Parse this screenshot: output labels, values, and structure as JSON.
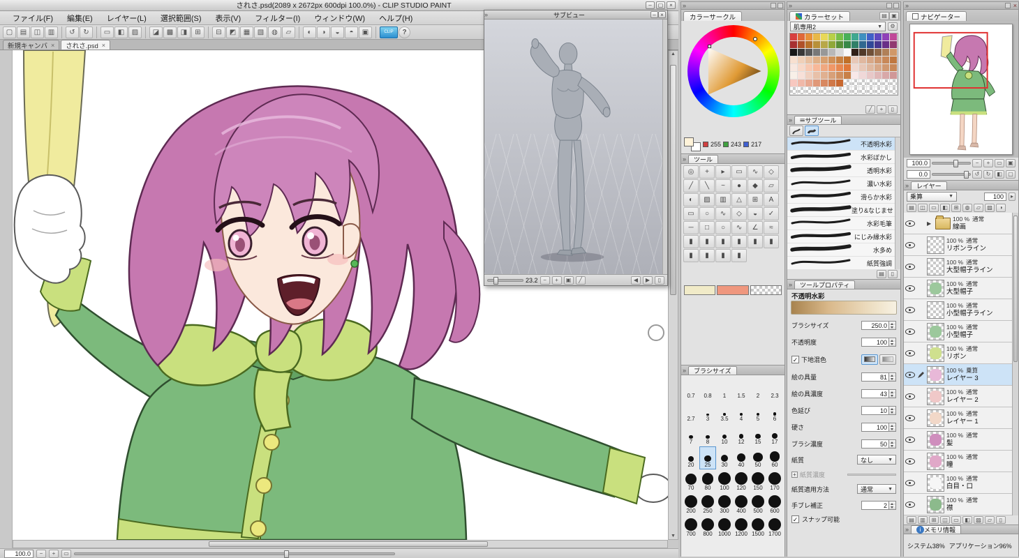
{
  "colors": {
    "selection": "#cde3f7",
    "accent_red": "#e03030",
    "fg_well": "#f1ebc8",
    "sub_well": "#ef977e",
    "current_color": "#fff3d9"
  },
  "window": {
    "title": "されさ.psd(2089 x 2672px 600dpi 100.0%) - CLIP STUDIO PAINT",
    "controls": [
      "minimize",
      "maximize",
      "close"
    ],
    "menus": [
      "ファイル(F)",
      "編集(E)",
      "レイヤー(L)",
      "選択範囲(S)",
      "表示(V)",
      "フィルター(I)",
      "ウィンドウ(W)",
      "ヘルプ(H)"
    ],
    "tabs": [
      {
        "label": "新規キャンバ",
        "active": false
      },
      {
        "label": "されさ.psd",
        "active": true
      }
    ],
    "toolbar_icons": [
      "new-file",
      "open-file",
      "save",
      "save-all",
      "undo",
      "redo",
      "cut",
      "copy",
      "paste",
      "deselect",
      "reselect",
      "invert-selection",
      "show-selection",
      "scale-rotate",
      "flip",
      "grid",
      "snap-ruler",
      "snap-special",
      "snap-grid",
      "guide",
      "measure",
      "operation-mode",
      "rotate-view",
      "reset-view",
      "clip-sync",
      "help"
    ],
    "status_zoom": "100.0"
  },
  "subview": {
    "title": "サブビュー",
    "zoom": "23.2"
  },
  "color_circle": {
    "tab": "カラーサークル",
    "r": "255",
    "g": "243",
    "b": "217"
  },
  "color_set": {
    "tab": "カラーセット",
    "preset": "肌専用2",
    "rows": [
      [
        "#d84040",
        "#e06838",
        "#e89038",
        "#e8b848",
        "#e8d858",
        "#b8d048",
        "#78c048",
        "#48b058",
        "#40a890",
        "#4090c0",
        "#4060c8",
        "#6048c0",
        "#9040b8",
        "#c04898"
      ],
      [
        "#a83030",
        "#b05028",
        "#b87028",
        "#b89038",
        "#b8a848",
        "#90a838",
        "#589038",
        "#388848",
        "#308068",
        "#306890",
        "#304898",
        "#483890",
        "#683088",
        "#903870"
      ],
      [
        "#181818",
        "#383838",
        "#585858",
        "#787878",
        "#989898",
        "#b8b8b8",
        "#d8d8d8",
        "#f8f8f8",
        "#302018",
        "#503828",
        "#705038",
        "#906848",
        "#b08058",
        "#d09868"
      ],
      [
        "#f8e0d0",
        "#f0d0b8",
        "#e8c0a0",
        "#e0b088",
        "#d8a070",
        "#d09058",
        "#c88040",
        "#c07028",
        "#e8c8b8",
        "#e0b8a0",
        "#d8a888",
        "#d09870",
        "#c88858",
        "#c07840"
      ],
      [
        "#f8e8e0",
        "#f8d8c8",
        "#f8c8b0",
        "#f8b898",
        "#f0a880",
        "#f09868",
        "#e88850",
        "#e07838",
        "#f0d8d0",
        "#e8c8b8",
        "#e0b8a0",
        "#d8a888",
        "#d09870",
        "#c88858"
      ],
      [
        "#f8f0e8",
        "#f8e0d8",
        "#f0d0c0",
        "#e8c0a8",
        "#e0b090",
        "#d8a078",
        "#d09060",
        "#c88048",
        "#f8e8e8",
        "#f0d8d8",
        "#e8c8c8",
        "#e0b8b8",
        "#d8a8a8",
        "#d09898"
      ],
      [
        "#f8c8c0",
        "#f0b8a8",
        "#e8a890",
        "#e09878",
        "#d88860",
        "#d07848",
        "#c86830",
        "T",
        "T",
        "T",
        "T",
        "T",
        "T",
        "T"
      ],
      [
        "T",
        "T",
        "T",
        "T",
        "T",
        "T",
        "T",
        "T",
        "T",
        "T",
        "T",
        "T",
        "T",
        "T"
      ]
    ]
  },
  "tool_panel": {
    "tab": "ツール",
    "rows": [
      [
        "zoom",
        "move",
        "operate",
        "select",
        "lasso",
        "wand"
      ],
      [
        "pen",
        "pencil",
        "brush",
        "airbrush",
        "decoration",
        "eraser"
      ],
      [
        "blend",
        "fill",
        "gradient",
        "figure",
        "frame",
        "text"
      ],
      [
        "marquee-rect",
        "marquee-ellipse",
        "marquee-lasso",
        "marquee-poly",
        "balloon",
        "correct-line"
      ],
      [
        "line",
        "rect",
        "ellipse",
        "curve",
        "polyline",
        "stream-line"
      ],
      [
        "nib-1",
        "nib-2",
        "nib-3",
        "nib-4",
        "nib-5",
        "nib-6"
      ],
      [
        "sel-pen",
        "sel-erase",
        "grad-fg",
        "grad-circle"
      ]
    ],
    "wells": {
      "main": "#f1ebc8",
      "sub": "#ef977e",
      "transparent": "checker"
    }
  },
  "subtool": {
    "tab": "サブツール",
    "items": [
      "不透明水彩",
      "水彩ぼかし",
      "透明水彩",
      "濃い水彩",
      "滑らか水彩",
      "塗り&なじませ",
      "水彩毛筆",
      "にじみ縁水彩",
      "水多め",
      "紙質強調"
    ],
    "selected_index": 0
  },
  "tool_property": {
    "tab": "ツールプロパティ",
    "tool_name": "不透明水彩",
    "settings": [
      {
        "label": "ブラシサイズ",
        "value": "250.0",
        "type": "spin"
      },
      {
        "label": "不透明度",
        "value": "100",
        "type": "spin"
      },
      {
        "label": "下地混色",
        "value": "",
        "type": "check",
        "checked": true
      },
      {
        "label": "絵の具量",
        "value": "81",
        "type": "spin"
      },
      {
        "label": "絵の具濃度",
        "value": "43",
        "type": "spin"
      },
      {
        "label": "色延び",
        "value": "10",
        "type": "spin"
      },
      {
        "label": "硬さ",
        "value": "100",
        "type": "spin"
      },
      {
        "label": "ブラシ濃度",
        "value": "50",
        "type": "spin"
      },
      {
        "label": "紙質",
        "value": "なし",
        "type": "dropdown"
      },
      {
        "label": "紙質濃度",
        "value": "",
        "type": "slider-disabled"
      },
      {
        "label": "紙質適用方法",
        "value": "通常",
        "type": "dropdown"
      },
      {
        "label": "手ブレ補正",
        "value": "2",
        "type": "spin"
      }
    ],
    "snap_label": "スナップ可能"
  },
  "brush_size": {
    "tab": "ブラシサイズ",
    "sizes": [
      "0.7",
      "0.8",
      "1",
      "1.5",
      "2",
      "2.3",
      "2.7",
      "3",
      "3.5",
      "4",
      "5",
      "6",
      "7",
      "8",
      "10",
      "12",
      "15",
      "17",
      "20",
      "25",
      "30",
      "40",
      "50",
      "60",
      "70",
      "80",
      "100",
      "120",
      "150",
      "170",
      "200",
      "250",
      "300",
      "400",
      "500",
      "600",
      "700",
      "800",
      "1000",
      "1200",
      "1500",
      "1700"
    ],
    "selected": "25"
  },
  "navigator": {
    "tab": "ナビゲーター",
    "zoom": "100.0",
    "rotation": "0.0"
  },
  "layers": {
    "tab": "レイヤー",
    "blend_mode": "乗算",
    "opacity": "100",
    "items": [
      {
        "opacity": "100 %",
        "mode": "通常",
        "name": "線画",
        "folder": true
      },
      {
        "opacity": "100 %",
        "mode": "通常",
        "name": "リボンライン"
      },
      {
        "opacity": "100 %",
        "mode": "通常",
        "name": "大型帽子ライン"
      },
      {
        "opacity": "100 %",
        "mode": "通常",
        "name": "大型帽子",
        "tint": "#9cc89c"
      },
      {
        "opacity": "100 %",
        "mode": "通常",
        "name": "小型帽子ライン"
      },
      {
        "opacity": "100 %",
        "mode": "通常",
        "name": "小型帽子",
        "tint": "#9cc89c"
      },
      {
        "opacity": "100 %",
        "mode": "通常",
        "name": "リボン",
        "tint": "#cfe08e"
      },
      {
        "opacity": "100 %",
        "mode": "乗算",
        "name": "レイヤー 3",
        "selected": true,
        "tint": "#e8b8d8"
      },
      {
        "opacity": "100 %",
        "mode": "通常",
        "name": "レイヤー 2",
        "tint": "#f0c8c8"
      },
      {
        "opacity": "100 %",
        "mode": "通常",
        "name": "レイヤー 1",
        "tint": "#f2d8c8"
      },
      {
        "opacity": "100 %",
        "mode": "通常",
        "name": "髪",
        "tint": "#cf8ebd"
      },
      {
        "opacity": "100 %",
        "mode": "通常",
        "name": "瞳",
        "tint": "#e0a8c8"
      },
      {
        "opacity": "100 %",
        "mode": "通常",
        "name": "白目・口",
        "tint": "#f6f6f6"
      },
      {
        "opacity": "100 %",
        "mode": "通常",
        "name": "襟",
        "tint": "#8cba8c"
      }
    ]
  },
  "memory": {
    "tab": "メモリ情報",
    "system_label": "システム38%",
    "app_label": "アプリケーション96%"
  }
}
